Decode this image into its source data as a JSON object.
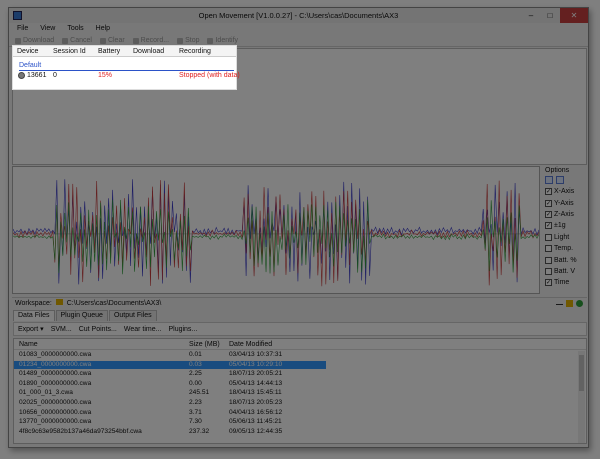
{
  "window": {
    "title": "Open Movement  [V1.0.0.27] - C:\\Users\\cas\\Documents\\AX3"
  },
  "menu": [
    "File",
    "View",
    "Tools",
    "Help"
  ],
  "toolbar": [
    "Download",
    "Cancel",
    "Clear",
    "Record...",
    "Stop",
    "Identify"
  ],
  "devices": {
    "columns": [
      "Device",
      "Session Id",
      "Battery",
      "Download",
      "Recording"
    ],
    "group": "Default",
    "row": {
      "device": "13661",
      "session": "0",
      "battery": "15%",
      "download": "",
      "recording": "Stopped (with data)"
    }
  },
  "options": {
    "title": "Options",
    "items": [
      {
        "label": "X-Axis",
        "checked": true
      },
      {
        "label": "Y-Axis",
        "checked": true
      },
      {
        "label": "Z-Axis",
        "checked": true
      },
      {
        "label": "±1g",
        "checked": true
      },
      {
        "label": "Light",
        "checked": false
      },
      {
        "label": "Temp.",
        "checked": false
      },
      {
        "label": "Batt. %",
        "checked": false
      },
      {
        "label": "Batt. V",
        "checked": false
      },
      {
        "label": "Time",
        "checked": true
      }
    ]
  },
  "workspace": {
    "label": "Workspace:",
    "path": "C:\\Users\\cas\\Documents\\AX3\\"
  },
  "tabs": [
    "Data Files",
    "Plugin Queue",
    "Output Files"
  ],
  "file_toolbar": [
    "Export ▾",
    "SVM...",
    "Cut Points...",
    "Wear time...",
    "Plugins..."
  ],
  "files": {
    "columns": [
      "Name",
      "Size (MB)",
      "Date Modified"
    ],
    "rows": [
      {
        "name": "01083_0000000000.cwa",
        "size": "0.01",
        "date": "03/04/13 10:37:31",
        "selected": false
      },
      {
        "name": "01234_0000000000.cwa",
        "size": "0.03",
        "date": "05/04/13 10:29:10",
        "selected": true
      },
      {
        "name": "01489_0000000000.cwa",
        "size": "2.25",
        "date": "18/07/13 20:05:21",
        "selected": false
      },
      {
        "name": "01890_0000000000.cwa",
        "size": "0.00",
        "date": "05/04/13 14:44:13",
        "selected": false
      },
      {
        "name": "01_000_01_3.cwa",
        "size": "245.51",
        "date": "18/04/13 15:45:11",
        "selected": false
      },
      {
        "name": "02025_0000000000.cwa",
        "size": "2.23",
        "date": "18/07/13 20:05:23",
        "selected": false
      },
      {
        "name": "10656_0000000000.cwa",
        "size": "3.71",
        "date": "04/04/13 16:56:12",
        "selected": false
      },
      {
        "name": "13770_0000000000.cwa",
        "size": "7.30",
        "date": "05/06/13 11:45:21",
        "selected": false
      },
      {
        "name": "4f8c9c63e9582b137a46da973254bbf.cwa",
        "size": "237.32",
        "date": "09/05/13 12:44:35",
        "selected": false
      }
    ]
  },
  "colors": {
    "accent": "#2b52c8",
    "alert": "#e02020",
    "selection": "#3399ff",
    "x_axis": "#3a3ac8",
    "y_axis": "#c83a3a",
    "z_axis": "#2f9e3a"
  }
}
